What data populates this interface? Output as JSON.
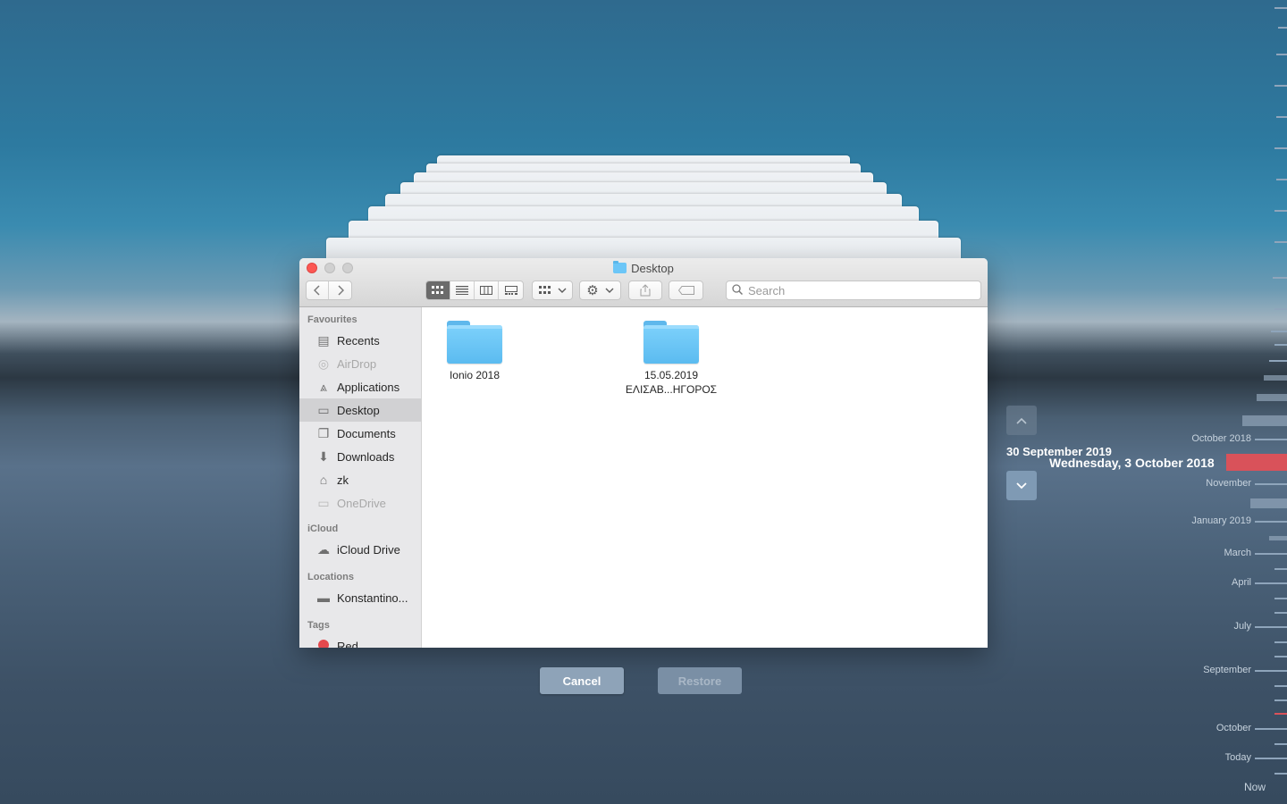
{
  "window": {
    "title": "Desktop",
    "search_placeholder": "Search"
  },
  "sidebar": {
    "favourites_heading": "Favourites",
    "favourites": [
      {
        "label": "Recents",
        "icon": "recents-icon",
        "dim": false
      },
      {
        "label": "AirDrop",
        "icon": "airdrop-icon",
        "dim": true
      },
      {
        "label": "Applications",
        "icon": "applications-icon",
        "dim": false
      },
      {
        "label": "Desktop",
        "icon": "desktop-icon",
        "dim": false,
        "selected": true
      },
      {
        "label": "Documents",
        "icon": "documents-icon",
        "dim": false
      },
      {
        "label": "Downloads",
        "icon": "downloads-icon",
        "dim": false
      },
      {
        "label": "zk",
        "icon": "home-icon",
        "dim": false
      },
      {
        "label": "OneDrive",
        "icon": "folder-icon",
        "dim": true
      }
    ],
    "icloud_heading": "iCloud",
    "icloud": [
      {
        "label": "iCloud Drive",
        "icon": "cloud-icon"
      }
    ],
    "locations_heading": "Locations",
    "locations": [
      {
        "label": "Konstantino...",
        "icon": "laptop-icon"
      }
    ],
    "tags_heading": "Tags",
    "tags": [
      {
        "label": "Red",
        "color": "#e5484d"
      }
    ]
  },
  "files": [
    {
      "line1": "Ionio 2018",
      "line2": ""
    },
    {
      "line1": "15.05.2019",
      "line2": "ΕΛΙΣΑΒ...ΗΓΟΡΟΣ"
    }
  ],
  "time_machine": {
    "cancel_label": "Cancel",
    "restore_label": "Restore",
    "snapshot_date": "30 September 2019",
    "current_date": "Wednesday, 3 October 2018",
    "timeline_labels": [
      "October 2018",
      "November",
      "January 2019",
      "March",
      "April",
      "July",
      "September",
      "October",
      "Today",
      "Now"
    ],
    "accent_color": "#d9525a"
  }
}
